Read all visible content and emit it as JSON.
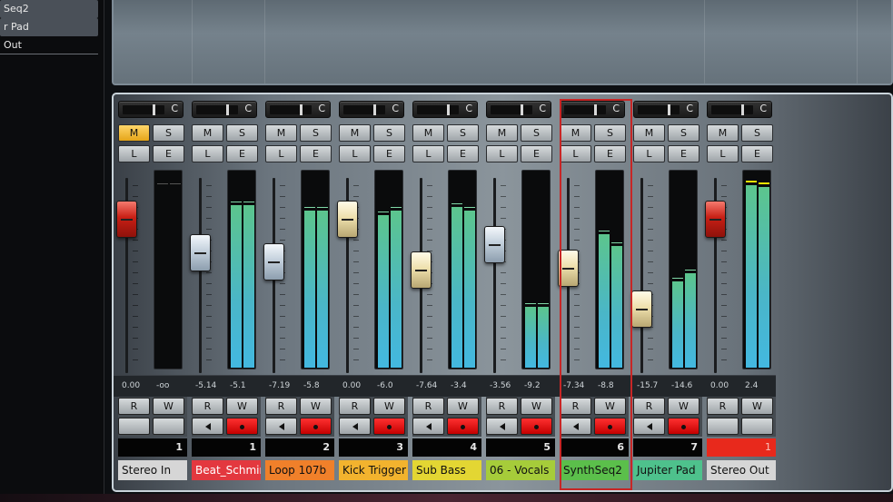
{
  "left_panel": {
    "items": [
      {
        "label": "Seq2",
        "selected": true
      },
      {
        "label": "r Pad",
        "selected": true
      },
      {
        "label": "Out",
        "selected": false
      }
    ]
  },
  "colors": {
    "accent_selection": "#c72626",
    "mute_active": "#f5c242",
    "record_active": "#e81e1e",
    "meter": "#4ab6c8"
  },
  "pan_label": "C",
  "buttons": {
    "mute": "M",
    "solo": "S",
    "listen": "L",
    "edit": "E",
    "read": "R",
    "write": "W"
  },
  "channels": [
    {
      "name": "Stereo In",
      "number": "1",
      "fader_db": "0.00",
      "peak_db": "-oo",
      "fader_level": 0.79,
      "meter_l": 0,
      "meter_r": 0,
      "fader_color": "red",
      "mute_on": true,
      "rec_row": false,
      "name_bg": "#d6d6d6",
      "number_style": "dark"
    },
    {
      "name": "Beat_Schmin",
      "number": "1",
      "fader_db": "-5.14",
      "peak_db": "-5.1",
      "fader_level": 0.62,
      "meter_l": 0.83,
      "meter_r": 0.83,
      "fader_color": "blue",
      "mute_on": false,
      "rec_row": true,
      "name_bg": "#e3383f",
      "number_style": "dark"
    },
    {
      "name": "Loop 107b",
      "number": "2",
      "fader_db": "-7.19",
      "peak_db": "-5.8",
      "fader_level": 0.57,
      "meter_l": 0.8,
      "meter_r": 0.8,
      "fader_color": "blue",
      "mute_on": false,
      "rec_row": true,
      "name_bg": "#f0802a",
      "number_style": "dark"
    },
    {
      "name": "Kick Trigger",
      "number": "3",
      "fader_db": "0.00",
      "peak_db": "-6.0",
      "fader_level": 0.79,
      "meter_l": 0.78,
      "meter_r": 0.8,
      "fader_color": "cream",
      "mute_on": false,
      "rec_row": true,
      "name_bg": "#f2b32e",
      "number_style": "dark"
    },
    {
      "name": "Sub Bass",
      "number": "4",
      "fader_db": "-7.64",
      "peak_db": "-3.4",
      "fader_level": 0.53,
      "meter_l": 0.82,
      "meter_r": 0.8,
      "fader_color": "cream",
      "mute_on": false,
      "rec_row": true,
      "name_bg": "#e3d633",
      "number_style": "dark"
    },
    {
      "name": "06 - Vocals",
      "number": "5",
      "fader_db": "-3.56",
      "peak_db": "-9.2",
      "fader_level": 0.66,
      "meter_l": 0.31,
      "meter_r": 0.31,
      "fader_color": "blue",
      "mute_on": false,
      "rec_row": true,
      "name_bg": "#a6cc3a",
      "number_style": "dark"
    },
    {
      "name": "SynthSeq2",
      "number": "6",
      "fader_db": "-7.34",
      "peak_db": "-8.8",
      "fader_level": 0.54,
      "meter_l": 0.68,
      "meter_r": 0.62,
      "fader_color": "cream",
      "mute_on": false,
      "rec_row": true,
      "name_bg": "#5bbf4b",
      "number_style": "dark",
      "selected": true
    },
    {
      "name": "Jupiter Pad",
      "number": "7",
      "fader_db": "-15.7",
      "peak_db": "-14.6",
      "fader_level": 0.33,
      "meter_l": 0.44,
      "meter_r": 0.48,
      "fader_color": "cream",
      "mute_on": false,
      "rec_row": true,
      "name_bg": "#4ec18c",
      "number_style": "dark"
    },
    {
      "name": "Stereo Out",
      "number": "1",
      "fader_db": "0.00",
      "peak_db": "2.4",
      "fader_level": 0.79,
      "meter_l": 0.93,
      "meter_r": 0.92,
      "fader_color": "red",
      "mute_on": false,
      "rec_row": false,
      "name_bg": "#d6d6d6",
      "number_style": "red"
    }
  ]
}
